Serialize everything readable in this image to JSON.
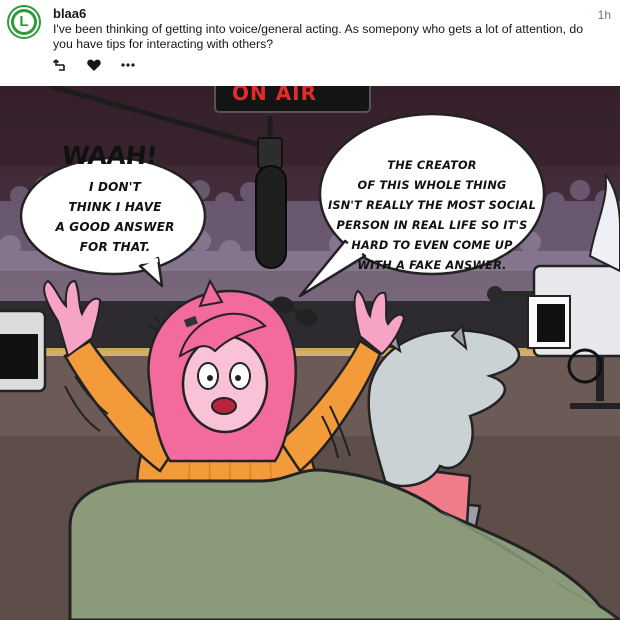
{
  "post": {
    "username": "blaa6",
    "timestamp": "1h",
    "avatar_letter": "L",
    "text": "I've been thinking of getting into voice/general acting. As somepony who gets a lot of attention, do you have tips for interacting with others?",
    "actions": [
      {
        "icon": "reply-icon"
      },
      {
        "icon": "heart-icon"
      },
      {
        "icon": "more-icon",
        "label": "•••"
      }
    ]
  },
  "comic": {
    "sign_text": "ON AIR",
    "left_bubble": {
      "exclaim": "WAAH!",
      "lines": [
        "I DON'T",
        "THINK I HAVE",
        "A GOOD ANSWER",
        "FOR THAT."
      ]
    },
    "right_bubble": {
      "lines": [
        "THE CREATOR",
        "OF THIS WHOLE THING",
        "ISN'T REALLY THE MOST SOCIAL",
        "PERSON IN REAL LIFE SO IT'S",
        "HARD TO EVEN COME UP",
        "WITH A FAKE ANSWER."
      ]
    }
  },
  "colors": {
    "brand_green": "#2e9b3a",
    "onair_red": "#e32b2b",
    "pony_pink": "#f36a9c",
    "sweater_orange": "#f39a3a",
    "couch_green": "#8c9a7c"
  }
}
